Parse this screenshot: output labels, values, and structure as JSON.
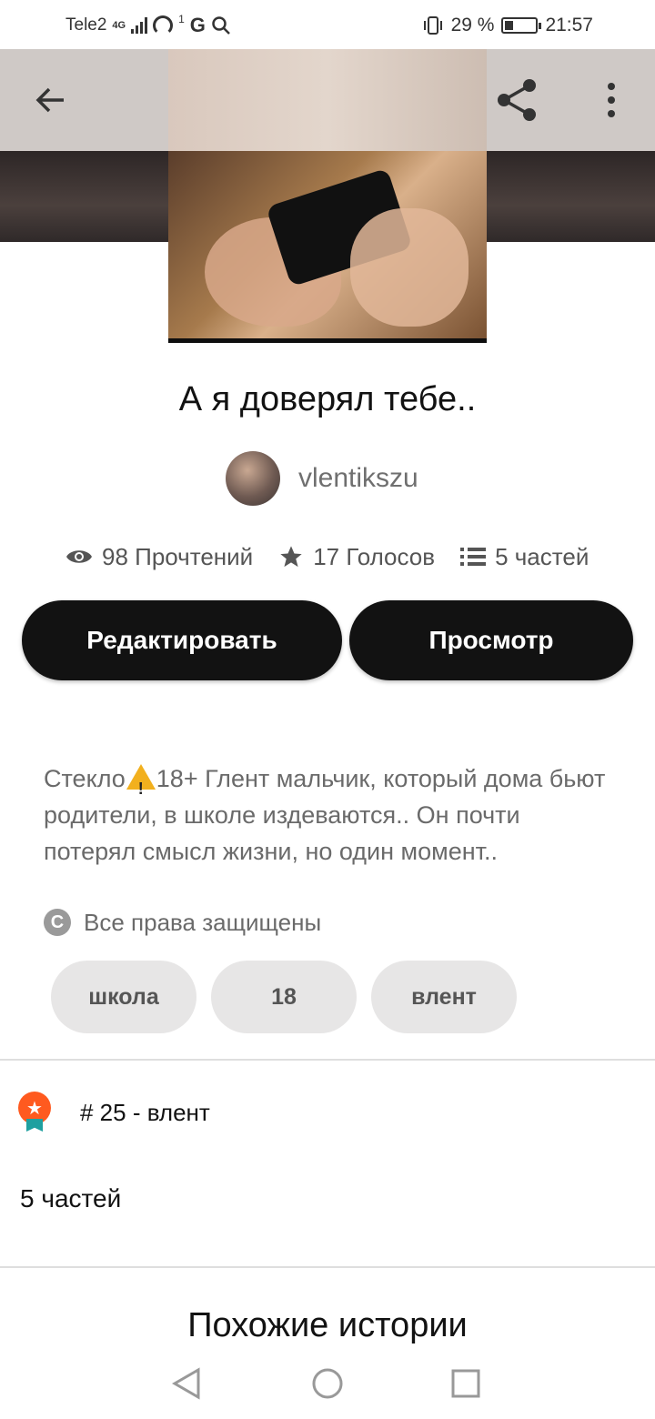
{
  "status_bar": {
    "carrier": "Tele2",
    "network": "4G",
    "notif_count": "1",
    "battery": "29 %",
    "battery_level": 0.29,
    "time": "21:57"
  },
  "toolbar": {
    "back_icon": "arrow-left-icon",
    "share_icon": "share-icon",
    "more_icon": "more-vertical-icon"
  },
  "story": {
    "title": "А я доверял тебе..",
    "author": "vlentikszu",
    "stats": {
      "reads": "98 Прочтений",
      "votes": "17 Голосов",
      "parts": "5 частей"
    },
    "edit_label": "Редактировать",
    "view_label": "Просмотр",
    "description_before": "Стекло",
    "description_after": "18+ Глент мальчик, который дома бьют родители, в школе издеваются.. Он почти потерял смысл жизни, но один момент..",
    "copyright": "Все права защищены",
    "copyright_symbol": "C",
    "tags": [
      "школа",
      "18",
      "влент"
    ],
    "rank": "# 25 - влент",
    "parts_count": "5 частей"
  },
  "similar": {
    "title": "Похожие истории"
  },
  "colors": {
    "primary_button": "#121212",
    "tag_bg": "#e7e6e6",
    "rank_badge": "#ff5a1f",
    "ribbon": "#1fa0a0",
    "warning": "#f2b01e"
  }
}
